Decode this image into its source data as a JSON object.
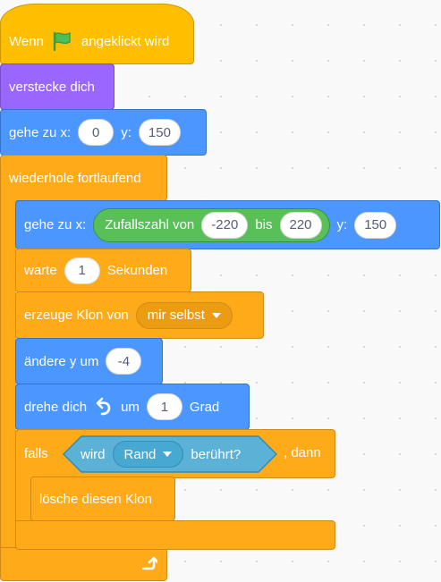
{
  "script": {
    "hat": {
      "text_before": "Wenn",
      "icon": "green-flag-icon",
      "text_after": "angeklickt wird"
    },
    "hide": {
      "label": "verstecke dich"
    },
    "goto_initial": {
      "label_x": "gehe zu x:",
      "x": "0",
      "label_y": "y:",
      "y": "150"
    },
    "forever": {
      "label": "wiederhole fortlaufend",
      "body": {
        "goto": {
          "label_x": "gehe zu x:",
          "random": {
            "label": "Zufallszahl von",
            "from": "-220",
            "to_label": "bis",
            "to": "220"
          },
          "label_y": "y:",
          "y": "150"
        },
        "wait": {
          "label": "warte",
          "value": "1",
          "unit": "Sekunden"
        },
        "clone": {
          "label": "erzeuge Klon von",
          "option": "mir selbst"
        },
        "change_y": {
          "label": "ändere y um",
          "value": "-4"
        },
        "turn": {
          "label": "drehe dich",
          "icon": "rotate-left-icon",
          "label_um": "um",
          "value": "1",
          "unit": "Grad"
        },
        "if": {
          "label_if": "falls",
          "sensing": {
            "label": "wird",
            "option": "Rand",
            "label_after": "berührt?"
          },
          "label_then": ", dann",
          "body": {
            "delete": {
              "label": "lösche diesen Klon"
            }
          }
        }
      },
      "loop_icon": "loop-arrow-icon"
    }
  },
  "colors": {
    "events": "#ffbf00",
    "looks": "#9966ff",
    "motion": "#4c97ff",
    "control": "#ffab19",
    "operators": "#59c059",
    "sensing": "#5cb1d6"
  }
}
